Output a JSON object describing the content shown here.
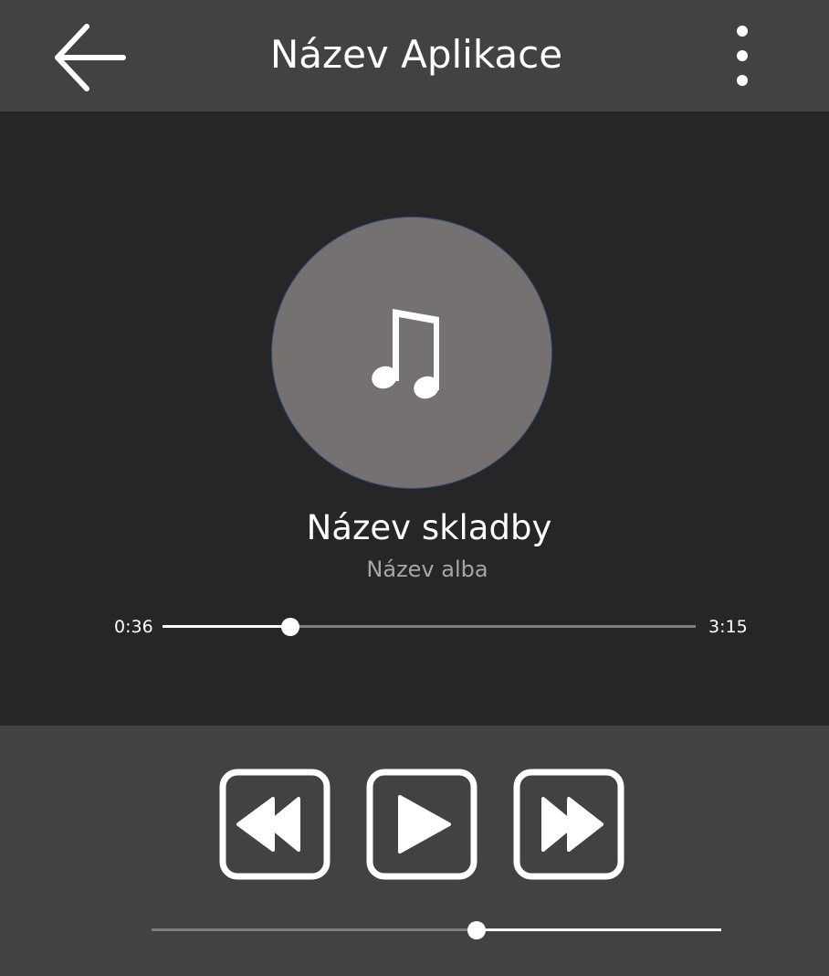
{
  "header": {
    "title": "Název Aplikace",
    "back_icon": "arrow-left-icon",
    "menu_icon": "more-vertical-icon"
  },
  "now_playing": {
    "album_art_icon": "music-note-icon",
    "track_title": "Název skladby",
    "album_name": "Název alba"
  },
  "progress": {
    "current_time": "0:36",
    "total_time": "3:15",
    "fraction": 0.24
  },
  "controls": {
    "rewind_icon": "rewind-icon",
    "play_icon": "play-icon",
    "forward_icon": "fast-forward-icon"
  },
  "volume": {
    "level": 0.57
  },
  "colors": {
    "header_bg": "#424242",
    "main_bg": "#262626",
    "controls_bg": "#424242",
    "album_art_bg": "#757171",
    "album_art_border": "#2f4b7c",
    "secondary_text": "#a6a6a6",
    "slider_track": "#7f7f7f",
    "accent": "#ffffff"
  }
}
